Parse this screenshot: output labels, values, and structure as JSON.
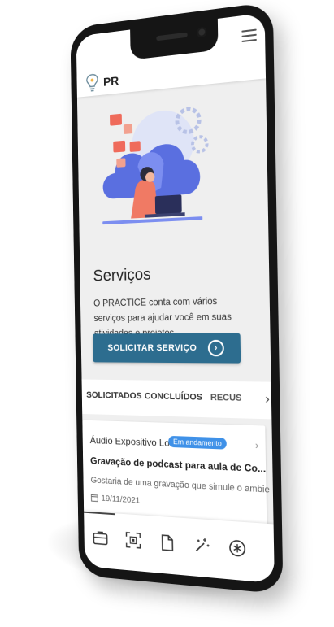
{
  "app": {
    "brand": "PR"
  },
  "header": {
    "menu_icon": "hamburger-menu-icon",
    "logo_icon": "lightbulb-icon"
  },
  "hero": {
    "illustration": "person-laptop-cloud-illustration"
  },
  "services": {
    "title": "Serviços",
    "description": "O PRACTICE conta com vários serviços para ajudar você em suas atividades e projetos.",
    "cta_label": "SOLICITAR SERVIÇO",
    "cta_icon": "chevron-right-circle-icon"
  },
  "tabs": [
    {
      "label": "SOLICITADOS"
    },
    {
      "label": "CONCLUÍDOS"
    },
    {
      "label": "RECUS"
    }
  ],
  "request_card": {
    "service_name": "Áudio Expositivo Lon...",
    "status": "Em andamento",
    "subject": "Gravação de podcast para aula de Co...",
    "excerpt": "Gostaria de uma gravação que simule o ambie",
    "date": "19/11/2021",
    "status_color": "#3f91e8"
  },
  "bottom_nav": [
    {
      "icon": "briefcase-icon",
      "active": true
    },
    {
      "icon": "qr-code-icon",
      "active": false
    },
    {
      "icon": "document-icon",
      "active": false
    },
    {
      "icon": "magic-wand-icon",
      "active": false
    },
    {
      "icon": "asterisk-circle-icon",
      "active": false
    }
  ],
  "colors": {
    "primary": "#2d6d8f",
    "badge": "#3f91e8",
    "background": "#efefef"
  }
}
